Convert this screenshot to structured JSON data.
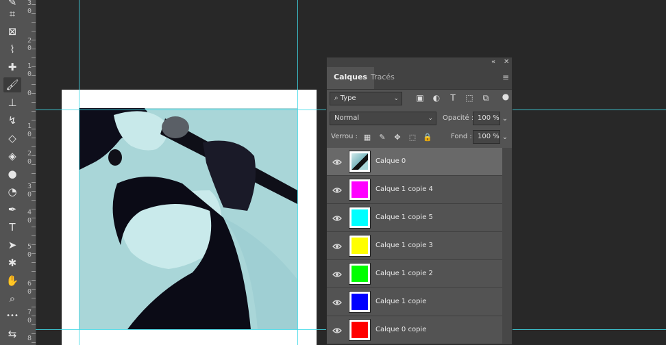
{
  "toolbar": {
    "tools": [
      {
        "icon": "pencil-icon",
        "glyph": "✎"
      },
      {
        "icon": "crop-icon",
        "glyph": "⌗"
      },
      {
        "icon": "frame-icon",
        "glyph": "⊠"
      },
      {
        "icon": "eyedropper-icon",
        "glyph": "⌇"
      },
      {
        "icon": "healing-brush-icon",
        "glyph": "✚"
      },
      {
        "icon": "brush-icon",
        "glyph": "🖌"
      },
      {
        "icon": "clone-stamp-icon",
        "glyph": "⊥"
      },
      {
        "icon": "history-brush-icon",
        "glyph": "↯"
      },
      {
        "icon": "eraser-icon",
        "glyph": "◇"
      },
      {
        "icon": "paint-bucket-icon",
        "glyph": "◈"
      },
      {
        "icon": "blur-icon",
        "glyph": "●"
      },
      {
        "icon": "dodge-icon",
        "glyph": "◔"
      },
      {
        "icon": "pen-icon",
        "glyph": "✒"
      },
      {
        "icon": "type-icon",
        "glyph": "T"
      },
      {
        "icon": "path-selection-icon",
        "glyph": "➤"
      },
      {
        "icon": "custom-shape-icon",
        "glyph": "✱"
      },
      {
        "icon": "hand-icon",
        "glyph": "✋"
      },
      {
        "icon": "zoom-icon",
        "glyph": "⌕"
      },
      {
        "icon": "more-tools-icon",
        "glyph": "•••"
      },
      {
        "icon": "swap-colors-icon",
        "glyph": "⇆"
      }
    ]
  },
  "ruler": {
    "digits": [
      "3",
      "0",
      "2",
      "0",
      "1",
      "0",
      "0",
      "1",
      "0",
      "2",
      "0",
      "3",
      "0",
      "4",
      "0",
      "5",
      "0",
      "6",
      "0",
      "7",
      "0",
      "8"
    ]
  },
  "panel": {
    "tabs": [
      "Calques",
      "Tracés"
    ],
    "filter_kind": "Type",
    "blend_mode": "Normal",
    "opacity_label": "Opacité :",
    "opacity_value": "100 %",
    "lock_label": "Verrou :",
    "fill_label": "Fond :",
    "fill_value": "100 %"
  },
  "layers": [
    {
      "name": "Calque 0",
      "color": "photo",
      "selected": true
    },
    {
      "name": "Calque 1 copie 4",
      "color": "#ff00ff",
      "selected": false
    },
    {
      "name": "Calque 1 copie 5",
      "color": "#00ffff",
      "selected": false
    },
    {
      "name": "Calque 1 copie 3",
      "color": "#ffff00",
      "selected": false
    },
    {
      "name": "Calque 1 copie 2",
      "color": "#00ff00",
      "selected": false
    },
    {
      "name": "Calque 1 copie",
      "color": "#0000ff",
      "selected": false
    },
    {
      "name": "Calque 0 copie",
      "color": "#ff0000",
      "selected": false
    }
  ],
  "colors": {
    "guide": "#3fd9e8",
    "canvas_bg": "#282828",
    "panel_bg": "#535353"
  }
}
